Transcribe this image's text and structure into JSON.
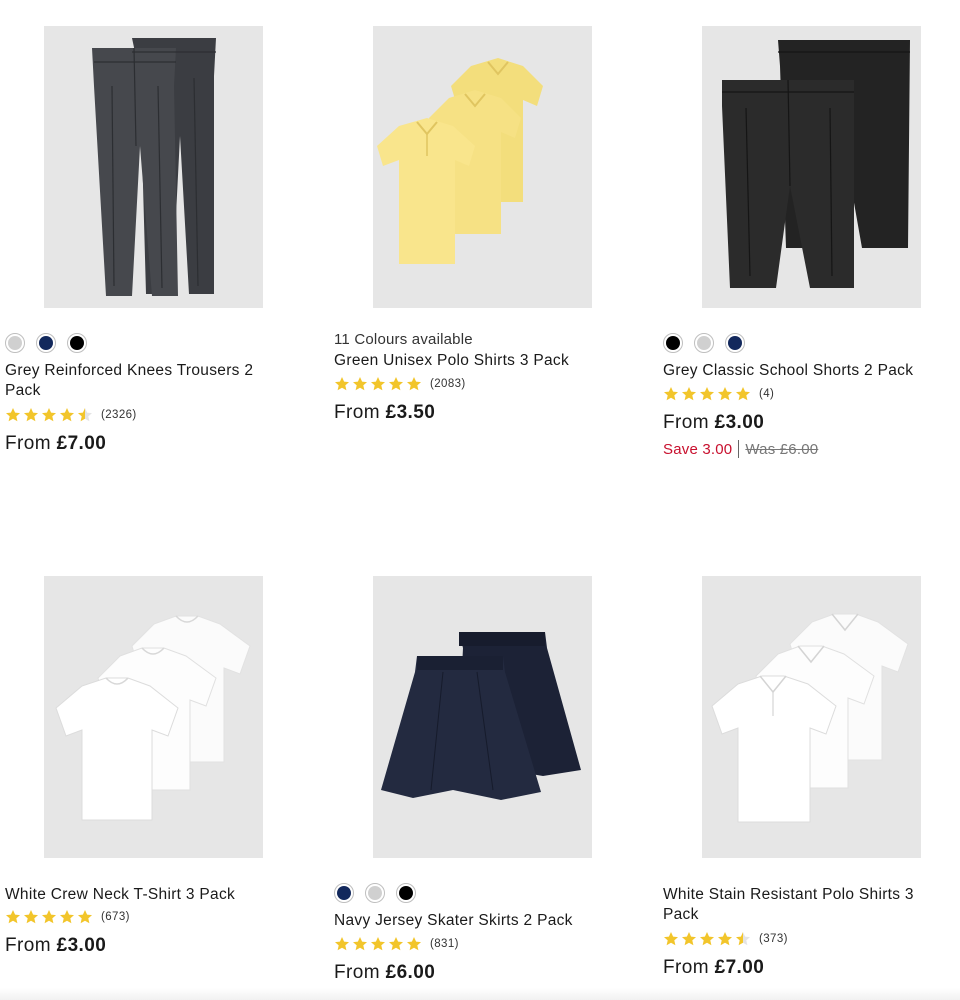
{
  "colors": {
    "star": "#f2c52b",
    "sale": "#c8102e",
    "image_bg": "#e6e6e6"
  },
  "products": [
    {
      "title": "Grey Reinforced Knees Trousers 2 Pack",
      "swatches": [
        "#d0d0d0",
        "#12285c",
        "#000000"
      ],
      "rating": 4.5,
      "reviews": "(2326)",
      "price_prefix": "From",
      "price": "£7.00"
    },
    {
      "title": "Green Unisex Polo Shirts 3 Pack",
      "colours_available": "11 Colours available",
      "rating": 5,
      "reviews": "(2083)",
      "price_prefix": "From",
      "price": "£3.50"
    },
    {
      "title": "Grey Classic School Shorts 2 Pack",
      "swatches": [
        "#000000",
        "#d0d0d0",
        "#12285c"
      ],
      "rating": 5,
      "reviews": "(4)",
      "price_prefix": "From",
      "price": "£3.00",
      "save": "Save 3.00",
      "was": "Was £6.00"
    },
    {
      "title": "White Crew Neck T-Shirt 3 Pack",
      "rating": 5,
      "reviews": "(673)",
      "price_prefix": "From",
      "price": "£3.00"
    },
    {
      "title": "Navy Jersey Skater Skirts 2 Pack",
      "swatches": [
        "#12285c",
        "#d0d0d0",
        "#000000"
      ],
      "rating": 5,
      "reviews": "(831)",
      "price_prefix": "From",
      "price": "£6.00"
    },
    {
      "title": "White Stain Resistant Polo Shirts 3 Pack",
      "rating": 4.5,
      "reviews": "(373)",
      "price_prefix": "From",
      "price": "£7.00"
    }
  ]
}
